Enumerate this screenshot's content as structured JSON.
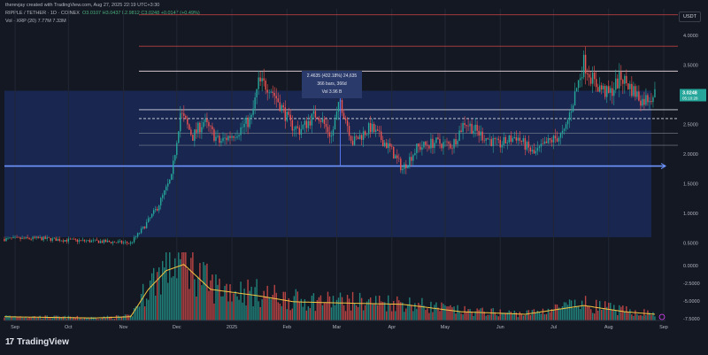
{
  "header": {
    "author_line": "therevjay created with TradingView.com, Aug 27, 2025 22:19 UTC+3:30",
    "symbol": "RIPPLE / TETHER · 1D · COINEX",
    "ohlc": "O3.0107  H3.0437  L2.9812  C3.0248  +0.0147 (+0.49%)",
    "volume": "Vol · XRP (20)  7.77M  7.33M",
    "currency_badge": "USDT"
  },
  "measure": {
    "line1": "2.4635 (432.18%) 24,635",
    "line2": "366 bars, 366d",
    "line3": "Vol 3.96 B"
  },
  "footer": {
    "brand": "TradingView",
    "logo_glyph": "17"
  },
  "colors": {
    "up": "#26a69a",
    "down": "#ef5350",
    "accent": "#2962ff",
    "zone": "#1e3a8a",
    "vol_ma": "#f5c542",
    "resistance": "#e04a4a"
  },
  "chart_data": {
    "type": "candlestick",
    "price_axis": {
      "ticks": [
        4.0,
        3.5,
        3.0,
        2.5,
        2.0,
        1.5,
        1.0,
        0.5
      ],
      "tick_labels": [
        "4.0000",
        "3.5000",
        "3.0000",
        "2.5000",
        "2.0000",
        "1.5000",
        "1.0000",
        "0.5000"
      ],
      "range": [
        0.45,
        4.45
      ],
      "last_price_label": "3.0248",
      "countdown_label": "05:10:28"
    },
    "volume_axis": {
      "tick_labels": [
        "0.0000",
        "-2.5000",
        "-5.0000",
        "-7.5000"
      ]
    },
    "x_labels": [
      "Sep",
      "Oct",
      "Nov",
      "Dec",
      "2025",
      "Feb",
      "Mar",
      "Apr",
      "May",
      "Jun",
      "Jul",
      "Aug",
      "Sep"
    ],
    "x_range": [
      "2024-08-26",
      "2025-09-02"
    ],
    "x_ticks": [
      "2024-09-01",
      "2024-10-01",
      "2024-11-01",
      "2024-12-01",
      "2025-01-01",
      "2025-02-01",
      "2025-03-01",
      "2025-04-01",
      "2025-05-01",
      "2025-06-01",
      "2025-07-01",
      "2025-08-01",
      "2025-09-01"
    ],
    "price_keypoints": [
      [
        "2024-08-26",
        0.57
      ],
      [
        "2024-09-15",
        0.58
      ],
      [
        "2024-10-01",
        0.55
      ],
      [
        "2024-10-25",
        0.52
      ],
      [
        "2024-11-05",
        0.5
      ],
      [
        "2024-11-12",
        0.75
      ],
      [
        "2024-11-20",
        1.1
      ],
      [
        "2024-11-28",
        1.6
      ],
      [
        "2024-12-03",
        2.7
      ],
      [
        "2024-12-10",
        2.3
      ],
      [
        "2024-12-16",
        2.55
      ],
      [
        "2024-12-25",
        2.2
      ],
      [
        "2025-01-05",
        2.4
      ],
      [
        "2025-01-12",
        2.6
      ],
      [
        "2025-01-16",
        3.2
      ],
      [
        "2025-01-22",
        3.15
      ],
      [
        "2025-01-27",
        2.9
      ],
      [
        "2025-02-03",
        2.5
      ],
      [
        "2025-02-08",
        2.4
      ],
      [
        "2025-02-18",
        2.7
      ],
      [
        "2025-02-26",
        2.3
      ],
      [
        "2025-03-03",
        2.9
      ],
      [
        "2025-03-10",
        2.2
      ],
      [
        "2025-03-20",
        2.45
      ],
      [
        "2025-03-31",
        2.1
      ],
      [
        "2025-04-07",
        1.75
      ],
      [
        "2025-04-15",
        2.1
      ],
      [
        "2025-04-25",
        2.2
      ],
      [
        "2025-05-05",
        2.15
      ],
      [
        "2025-05-12",
        2.55
      ],
      [
        "2025-05-20",
        2.35
      ],
      [
        "2025-05-31",
        2.15
      ],
      [
        "2025-06-10",
        2.3
      ],
      [
        "2025-06-20",
        2.0
      ],
      [
        "2025-06-28",
        2.2
      ],
      [
        "2025-07-07",
        2.35
      ],
      [
        "2025-07-12",
        2.9
      ],
      [
        "2025-07-18",
        3.55
      ],
      [
        "2025-07-24",
        3.2
      ],
      [
        "2025-08-01",
        3.0
      ],
      [
        "2025-08-08",
        3.3
      ],
      [
        "2025-08-14",
        3.1
      ],
      [
        "2025-08-20",
        2.9
      ],
      [
        "2025-08-27",
        3.02
      ]
    ],
    "volume_keypoints": [
      [
        "2024-08-26",
        0.3
      ],
      [
        "2024-10-15",
        0.2
      ],
      [
        "2024-11-05",
        0.3
      ],
      [
        "2024-11-15",
        2.5
      ],
      [
        "2024-11-25",
        4.0
      ],
      [
        "2024-12-05",
        4.5
      ],
      [
        "2024-12-20",
        2.5
      ],
      [
        "2025-01-15",
        2.0
      ],
      [
        "2025-02-05",
        1.5
      ],
      [
        "2025-03-05",
        1.4
      ],
      [
        "2025-04-07",
        1.3
      ],
      [
        "2025-05-10",
        0.7
      ],
      [
        "2025-06-15",
        0.5
      ],
      [
        "2025-07-18",
        1.2
      ],
      [
        "2025-08-10",
        0.7
      ],
      [
        "2025-08-27",
        0.5
      ]
    ],
    "levels": {
      "resistance": [
        4.35,
        3.82,
        3.4
      ],
      "white": [
        3.4,
        2.75
      ],
      "dashed": 2.6,
      "grey": [
        2.35,
        2.15
      ],
      "support_blue": 1.8
    },
    "zone": {
      "top": 3.07,
      "bottom": 0.6,
      "start": "2024-08-26",
      "end": "2025-08-25"
    },
    "measure_vertical": {
      "date": "2025-03-03",
      "from": 1.8,
      "to": 3.07
    }
  }
}
